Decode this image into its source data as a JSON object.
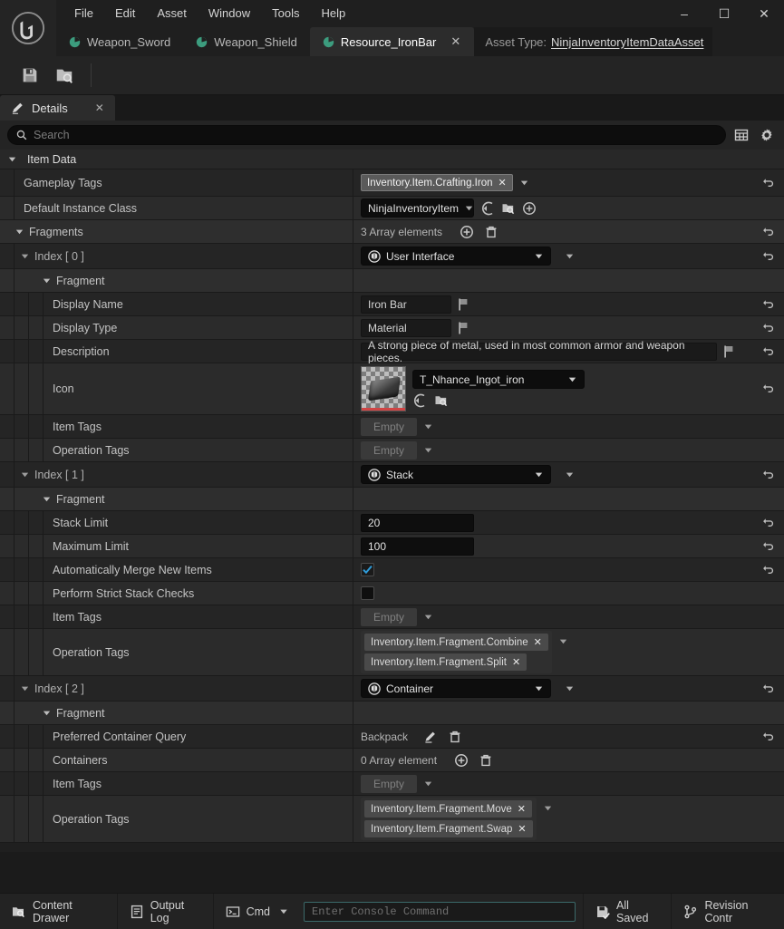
{
  "window": {
    "menus": [
      "File",
      "Edit",
      "Asset",
      "Window",
      "Tools",
      "Help"
    ],
    "controls": {
      "minimize": "–",
      "maximize": "☐",
      "close": "✕"
    }
  },
  "tabs": [
    {
      "label": "Weapon_Sword",
      "active": false
    },
    {
      "label": "Weapon_Shield",
      "active": false
    },
    {
      "label": "Resource_IronBar",
      "active": true,
      "close": "✕"
    }
  ],
  "asset_type": {
    "label": "Asset Type:",
    "value": "NinjaInventoryItemDataAsset"
  },
  "toolbar": {
    "save": "save-icon",
    "browse": "browse-icon"
  },
  "panel": {
    "tab_label": "Details",
    "close": "✕"
  },
  "search": {
    "placeholder": "Search",
    "value": "",
    "grid_icon": "grid-icon",
    "settings_icon": "gear-icon"
  },
  "categories": {
    "item_data": "Item Data"
  },
  "rows": {
    "gameplay_tags": {
      "label": "Gameplay Tags",
      "tag": "Inventory.Item.Crafting.Iron"
    },
    "default_instance_class": {
      "label": "Default Instance Class",
      "value": "NinjaInventoryItem"
    },
    "fragments": {
      "label": "Fragments",
      "count": "3 Array elements"
    },
    "index0": {
      "label": "Index [ 0 ]",
      "type": "User Interface"
    },
    "fragment": {
      "label": "Fragment"
    },
    "display_name": {
      "label": "Display Name",
      "value": "Iron Bar"
    },
    "display_type": {
      "label": "Display Type",
      "value": "Material"
    },
    "description": {
      "label": "Description",
      "value": "A strong piece of metal, used in most common armor and weapon pieces."
    },
    "icon": {
      "label": "Icon",
      "texture": "T_Nhance_Ingot_iron"
    },
    "item_tags_0": {
      "label": "Item Tags",
      "value": "Empty"
    },
    "operation_tags_0": {
      "label": "Operation Tags",
      "value": "Empty"
    },
    "index1": {
      "label": "Index [ 1 ]",
      "type": "Stack"
    },
    "stack_limit": {
      "label": "Stack Limit",
      "value": "20"
    },
    "maximum_limit": {
      "label": "Maximum Limit",
      "value": "100"
    },
    "auto_merge": {
      "label": "Automatically Merge New Items",
      "checked": true
    },
    "strict_checks": {
      "label": "Perform Strict Stack Checks",
      "checked": false
    },
    "item_tags_1": {
      "label": "Item Tags",
      "value": "Empty"
    },
    "operation_tags_1": {
      "label": "Operation Tags",
      "tags": [
        "Inventory.Item.Fragment.Combine",
        "Inventory.Item.Fragment.Split"
      ]
    },
    "index2": {
      "label": "Index [ 2 ]",
      "type": "Container"
    },
    "preferred_container_query": {
      "label": "Preferred Container Query",
      "value": "Backpack"
    },
    "containers": {
      "label": "Containers",
      "count": "0 Array element"
    },
    "item_tags_2": {
      "label": "Item Tags",
      "value": "Empty"
    },
    "operation_tags_2": {
      "label": "Operation Tags",
      "tags": [
        "Inventory.Item.Fragment.Move",
        "Inventory.Item.Fragment.Swap"
      ]
    }
  },
  "statusbar": {
    "content_drawer": "Content Drawer",
    "output_log": "Output Log",
    "cmd": "Cmd",
    "console_placeholder": "Enter Console Command",
    "all_saved": "All Saved",
    "revision_control": "Revision Contr"
  },
  "colors": {
    "accent_blue": "#2f9bd8",
    "tag_green": "#3c9c7e",
    "thumb_red": "#d04545",
    "console_border": "#3b6a6a"
  }
}
